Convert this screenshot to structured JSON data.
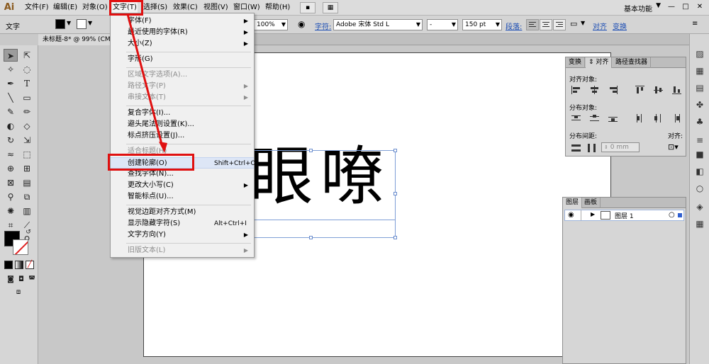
{
  "app": {
    "logo_text": "Ai",
    "workspace": "基本功能"
  },
  "menubar": {
    "items": [
      "文件(F)",
      "编辑(E)",
      "对象(O)",
      "文字(T)",
      "选择(S)",
      "效果(C)",
      "视图(V)",
      "窗口(W)",
      "帮助(H)"
    ],
    "active_index": 3
  },
  "control_bar": {
    "object_type": "文字",
    "zoom_field": "100%",
    "char_label": "字符:",
    "font_family": "Adobe 宋体 Std L",
    "font_style": "-",
    "font_size": "150 pt",
    "paragraph_label": "段落:",
    "align_label": "对齐",
    "transform_label": "变换"
  },
  "document": {
    "tab_title": "未标题-8* @ 99% (CM"
  },
  "canvas": {
    "text": "眼嘹"
  },
  "type_menu": {
    "items": [
      {
        "label": "字体(F)",
        "submenu": true,
        "disabled": false
      },
      {
        "label": "最近使用的字体(R)",
        "submenu": true,
        "disabled": false
      },
      {
        "label": "大小(Z)",
        "submenu": true,
        "disabled": false
      },
      {
        "label": "字形(G)",
        "submenu": false,
        "disabled": false
      },
      {
        "label": "区域文字选项(A)...",
        "submenu": false,
        "disabled": true
      },
      {
        "label": "路径文字(P)",
        "submenu": true,
        "disabled": true
      },
      {
        "label": "串接文本(T)",
        "submenu": true,
        "disabled": true
      },
      {
        "label": "复合字体(I)...",
        "submenu": false,
        "disabled": false
      },
      {
        "label": "避头尾法则设置(K)...",
        "submenu": false,
        "disabled": false
      },
      {
        "label": "标点挤压设置(J)...",
        "submenu": false,
        "disabled": false
      },
      {
        "label": "适合标题(H)",
        "submenu": false,
        "disabled": true
      },
      {
        "label": "创建轮廓(O)",
        "shortcut": "Shift+Ctrl+O",
        "submenu": false,
        "disabled": false
      },
      {
        "label": "查找字体(N)...",
        "submenu": false,
        "disabled": false
      },
      {
        "label": "更改大小写(C)",
        "submenu": true,
        "disabled": false
      },
      {
        "label": "智能标点(U)...",
        "submenu": false,
        "disabled": false
      },
      {
        "label": "视觉边距对齐方式(M)",
        "submenu": false,
        "disabled": false
      },
      {
        "label": "显示隐藏字符(S)",
        "shortcut": "Alt+Ctrl+I",
        "submenu": false,
        "disabled": false
      },
      {
        "label": "文字方向(Y)",
        "submenu": true,
        "disabled": false
      },
      {
        "label": "旧版文本(L)",
        "submenu": true,
        "disabled": true
      }
    ],
    "highlighted_index": 11
  },
  "align_panel": {
    "tabs": [
      "变换",
      "对齐",
      "路径查找器"
    ],
    "active_tab": 1,
    "align_objects_label": "对齐对象:",
    "distribute_objects_label": "分布对象:",
    "distribute_spacing_label": "分布间距:",
    "align_to_label": "对齐:",
    "spacing_value": "0 mm"
  },
  "layers_panel": {
    "tabs": [
      "图层",
      "画板"
    ],
    "active_tab": 0,
    "layer_name": "图层 1"
  },
  "colors": {
    "highlight_red": "#e01010",
    "accent_blue": "#1a4cb3"
  }
}
